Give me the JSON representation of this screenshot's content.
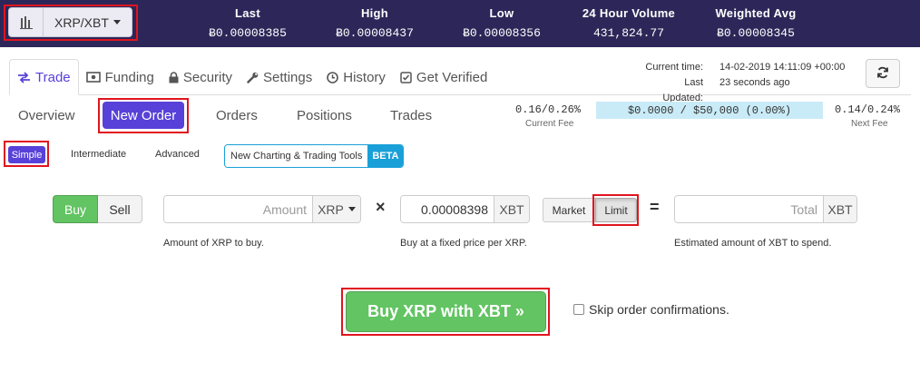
{
  "header": {
    "pair_label": "XRP/XBT",
    "stats": [
      {
        "label": "Last",
        "value": "Ƀ0.00008385"
      },
      {
        "label": "High",
        "value": "Ƀ0.00008437"
      },
      {
        "label": "Low",
        "value": "Ƀ0.00008356"
      },
      {
        "label": "24 Hour Volume",
        "value": "431,824.77"
      },
      {
        "label": "Weighted Avg",
        "value": "Ƀ0.00008345"
      }
    ]
  },
  "nav": {
    "tabs": [
      {
        "label": "Trade",
        "icon": "exchange-icon",
        "active": true
      },
      {
        "label": "Funding",
        "icon": "money-icon"
      },
      {
        "label": "Security",
        "icon": "lock-icon"
      },
      {
        "label": "Settings",
        "icon": "wrench-icon"
      },
      {
        "label": "History",
        "icon": "clock-icon"
      },
      {
        "label": "Get Verified",
        "icon": "check-square-icon"
      }
    ],
    "current_time_label": "Current time:",
    "current_time_value": "14-02-2019 14:11:09 +00:00",
    "last_updated_label": "Last Updated:",
    "last_updated_value": "23 seconds ago"
  },
  "subtabs": {
    "items": [
      "Overview",
      "New Order",
      "Orders",
      "Positions",
      "Trades"
    ],
    "active": "New Order"
  },
  "fees": {
    "current_value": "0.16/0.26%",
    "current_label": "Current Fee",
    "progress_text": "$0.0000 / $50,000 (0.00%)",
    "progress_fraction": 0.0,
    "next_value": "0.14/0.24%",
    "next_label": "Next Fee"
  },
  "modes": {
    "simple": "Simple",
    "intermediate": "Intermediate",
    "advanced": "Advanced",
    "chart_tools": "New Charting & Trading Tools",
    "beta": "BETA"
  },
  "order": {
    "buy_label": "Buy",
    "sell_label": "Sell",
    "amount_placeholder": "Amount",
    "amount_currency": "XRP",
    "amount_help": "Amount of XRP to buy.",
    "times_symbol": "×",
    "price_value": "0.00008398",
    "price_currency": "XBT",
    "price_help": "Buy at a fixed price per XRP.",
    "market_label": "Market",
    "limit_label": "Limit",
    "equals_symbol": "=",
    "total_placeholder": "Total",
    "total_currency": "XBT",
    "total_help": "Estimated amount of XBT to spend.",
    "submit_label": "Buy XRP with XBT »",
    "skip_label": "Skip order confirmations.",
    "skip_checked": false
  },
  "colors": {
    "header_bg": "#2d2759",
    "accent": "#5841d8",
    "buy_green": "#62c462",
    "fee_bar": "#c9ebf7",
    "beta_blue": "#1aa0d8",
    "highlight_red": "#e0141e"
  }
}
